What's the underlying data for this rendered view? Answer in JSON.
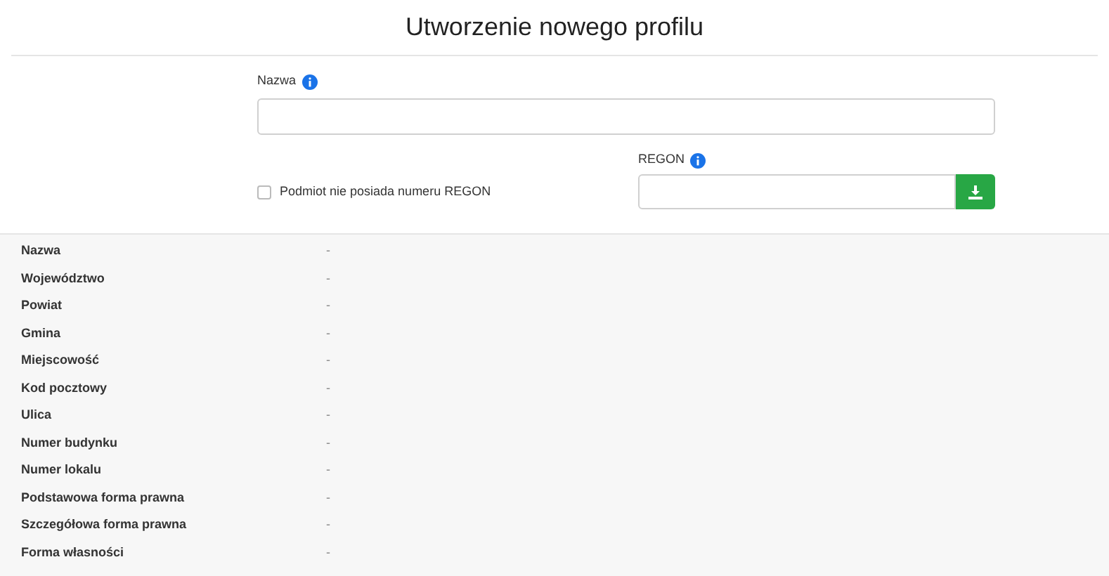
{
  "title": "Utworzenie nowego profilu",
  "name_field": {
    "label": "Nazwa"
  },
  "no_regon": {
    "label": "Podmiot nie posiada numeru REGON",
    "checked": false
  },
  "regon_field": {
    "label": "REGON"
  },
  "details": [
    {
      "label": "Nazwa",
      "value": "-"
    },
    {
      "label": "Województwo",
      "value": "-"
    },
    {
      "label": "Powiat",
      "value": "-"
    },
    {
      "label": "Gmina",
      "value": "-"
    },
    {
      "label": "Miejscowość",
      "value": "-"
    },
    {
      "label": "Kod pocztowy",
      "value": "-"
    },
    {
      "label": "Ulica",
      "value": "-"
    },
    {
      "label": "Numer budynku",
      "value": "-"
    },
    {
      "label": "Numer lokalu",
      "value": "-"
    },
    {
      "label": "Podstawowa forma prawna",
      "value": "-"
    },
    {
      "label": "Szczegółowa forma prawna",
      "value": "-"
    },
    {
      "label": "Forma własności",
      "value": "-"
    }
  ]
}
